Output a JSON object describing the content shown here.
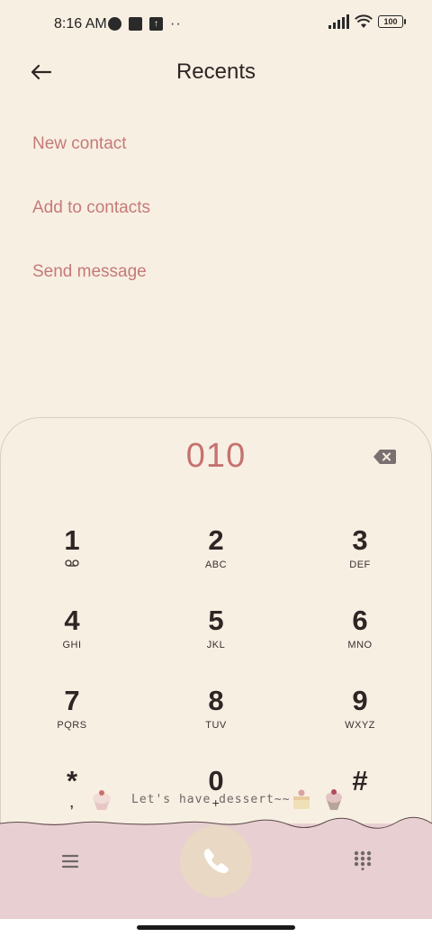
{
  "status": {
    "time": "8:16 AM",
    "battery": "100",
    "dots": "··"
  },
  "header": {
    "title": "Recents"
  },
  "actions": [
    {
      "label": "New contact"
    },
    {
      "label": "Add to contacts"
    },
    {
      "label": "Send message"
    }
  ],
  "dialer": {
    "number": "010",
    "decoration_text": "Let's have dessert~~",
    "keys": [
      {
        "digit": "1",
        "letters": ""
      },
      {
        "digit": "2",
        "letters": "ABC"
      },
      {
        "digit": "3",
        "letters": "DEF"
      },
      {
        "digit": "4",
        "letters": "GHI"
      },
      {
        "digit": "5",
        "letters": "JKL"
      },
      {
        "digit": "6",
        "letters": "MNO"
      },
      {
        "digit": "7",
        "letters": "PQRS"
      },
      {
        "digit": "8",
        "letters": "TUV"
      },
      {
        "digit": "9",
        "letters": "WXYZ"
      },
      {
        "digit": "*",
        "letters": ","
      },
      {
        "digit": "0",
        "letters": "+"
      },
      {
        "digit": "#",
        "letters": ""
      }
    ]
  },
  "icons": {
    "back": "arrow-left-icon",
    "backspace": "backspace-icon",
    "voicemail": "voicemail-icon",
    "menu": "menu-icon",
    "call": "phone-icon",
    "keypad": "keypad-grid-icon"
  },
  "colors": {
    "accent": "#c57a78",
    "background": "#f8efe3",
    "bottom_bar": "#e8cfd1",
    "call_button": "#e8d8c4"
  }
}
